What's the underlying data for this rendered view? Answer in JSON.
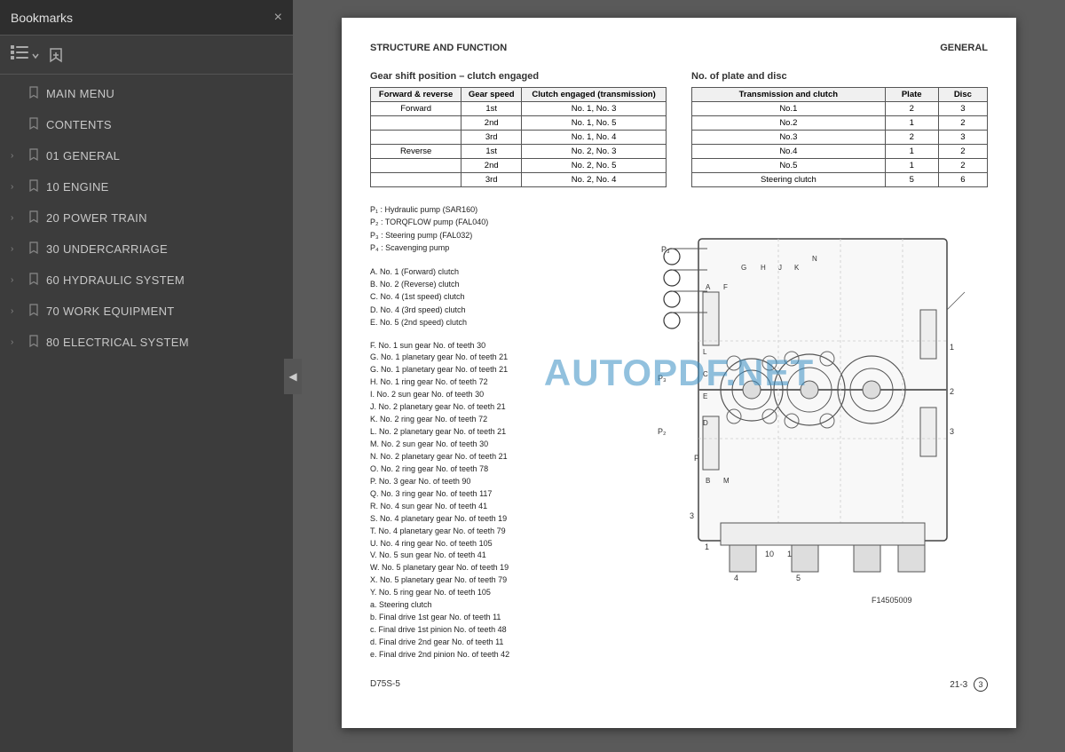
{
  "sidebar": {
    "title": "Bookmarks",
    "close_label": "×",
    "toolbar": {
      "list_icon": "☰",
      "bookmark_icon": "🔖"
    },
    "items": [
      {
        "id": "main-menu",
        "label": "MAIN MENU",
        "has_arrow": false
      },
      {
        "id": "contents",
        "label": "CONTENTS",
        "has_arrow": false
      },
      {
        "id": "general",
        "label": "01 GENERAL",
        "has_arrow": true
      },
      {
        "id": "engine",
        "label": "10 ENGINE",
        "has_arrow": true
      },
      {
        "id": "power-train",
        "label": "20 POWER TRAIN",
        "has_arrow": true
      },
      {
        "id": "undercarriage",
        "label": "30 UNDERCARRIAGE",
        "has_arrow": true
      },
      {
        "id": "hydraulic",
        "label": "60 HYDRAULIC SYSTEM",
        "has_arrow": true
      },
      {
        "id": "work-equipment",
        "label": "70 WORK EQUIPMENT",
        "has_arrow": true
      },
      {
        "id": "electrical",
        "label": "80 ELECTRICAL SYSTEM",
        "has_arrow": true
      }
    ],
    "collapse_arrow": "◀"
  },
  "page": {
    "header_left": "STRUCTURE AND FUNCTION",
    "header_right": "GENERAL",
    "watermark": "AUTOPDF.NET",
    "gear_table": {
      "title": "Gear shift position – clutch engaged",
      "headers": [
        "Forward & reverse",
        "Gear speed",
        "Clutch engaged (transmission)"
      ],
      "rows": [
        [
          "Forward",
          "1st",
          "No. 1, No. 3"
        ],
        [
          "",
          "2nd",
          "No. 1, No. 5"
        ],
        [
          "",
          "3rd",
          "No. 1, No. 4"
        ],
        [
          "Reverse",
          "1st",
          "No. 2, No. 3"
        ],
        [
          "",
          "2nd",
          "No. 2, No. 5"
        ],
        [
          "",
          "3rd",
          "No. 2, No. 4"
        ]
      ]
    },
    "plate_table": {
      "title": "No. of plate and disc",
      "headers": [
        "Transmission and clutch",
        "Plate",
        "Disc"
      ],
      "rows": [
        [
          "No.1",
          "2",
          "3"
        ],
        [
          "No.2",
          "1",
          "2"
        ],
        [
          "No.3",
          "2",
          "3"
        ],
        [
          "No.4",
          "1",
          "2"
        ],
        [
          "No.5",
          "1",
          "2"
        ],
        [
          "Steering clutch",
          "5",
          "6"
        ]
      ]
    },
    "pumps": [
      "P₁ : Hydraulic pump (SAR160)",
      "P₂ : TORQFLOW pump (FAL040)",
      "P₃ : Steering pump (FAL032)",
      "P₄ : Scavenging pump"
    ],
    "clutches": [
      "A.  No. 1 (Forward) clutch",
      "B.  No. 2 (Reverse) clutch",
      "C.  No. 4 (1st speed) clutch",
      "D.  No. 4 (3rd speed) clutch",
      "E.  No. 5 (2nd speed) clutch"
    ],
    "components": [
      {
        "letter": "F.",
        "name": "No. 1 sun gear",
        "detail": "No. of teeth",
        "value": "30"
      },
      {
        "letter": "G.",
        "name": "No. 1 planetary gear",
        "detail": "No. of teeth",
        "value": "21"
      },
      {
        "letter": "G.",
        "name": "No. 1 planetary gear",
        "detail": "No. of teeth",
        "value": "21"
      },
      {
        "letter": "H.",
        "name": "No. 1 ring gear",
        "detail": "No. of teeth",
        "value": "72"
      },
      {
        "letter": "I.",
        "name": "No. 2 sun gear",
        "detail": "No. of teeth",
        "value": "30"
      },
      {
        "letter": "J.",
        "name": "No. 2 planetary gear",
        "detail": "No. of teeth",
        "value": "21"
      },
      {
        "letter": "K.",
        "name": "No. 2 ring gear",
        "detail": "No. of teeth",
        "value": "72"
      },
      {
        "letter": "L.",
        "name": "No. 2 planetary gear",
        "detail": "No. of teeth",
        "value": "21"
      },
      {
        "letter": "M.",
        "name": "No. 2 sun gear",
        "detail": "No. of teeth",
        "value": "30"
      },
      {
        "letter": "N.",
        "name": "No. 2 planetary gear",
        "detail": "No. of teeth",
        "value": "21"
      },
      {
        "letter": "O.",
        "name": "No. 2 ring gear",
        "detail": "No. of teeth",
        "value": "78"
      },
      {
        "letter": "P.",
        "name": "No. 3 gear",
        "detail": "No. of teeth",
        "value": "90"
      },
      {
        "letter": "Q.",
        "name": "No. 3 ring gear",
        "detail": "No. of teeth",
        "value": "117"
      },
      {
        "letter": "R.",
        "name": "No. 4 sun gear",
        "detail": "No. of teeth",
        "value": "41"
      },
      {
        "letter": "S.",
        "name": "No. 4 planetary gear",
        "detail": "No. of teeth",
        "value": "19"
      },
      {
        "letter": "T.",
        "name": "No. 4 planetary gear",
        "detail": "No. of teeth",
        "value": "79"
      },
      {
        "letter": "U.",
        "name": "No. 4 ring gear",
        "detail": "No. of teeth",
        "value": "105"
      },
      {
        "letter": "V.",
        "name": "No. 5 sun gear",
        "detail": "No. of teeth",
        "value": "41"
      },
      {
        "letter": "W.",
        "name": "No. 5 planetary gear",
        "detail": "No. of teeth",
        "value": "19"
      },
      {
        "letter": "X.",
        "name": "No. 5 planetary gear",
        "detail": "No. of teeth",
        "value": "79"
      },
      {
        "letter": "Y.",
        "name": "No. 5 ring gear",
        "detail": "No. of teeth",
        "value": "105"
      },
      {
        "letter": "a.",
        "name": "Steering clutch",
        "detail": "",
        "value": ""
      },
      {
        "letter": "b.",
        "name": "Final drive 1st gear",
        "detail": "No. of teeth",
        "value": "11"
      },
      {
        "letter": "c.",
        "name": "Final drive 1st pinion",
        "detail": "No. of teeth",
        "value": "48"
      },
      {
        "letter": "d.",
        "name": "Final drive 2nd gear",
        "detail": "No. of teeth",
        "value": "11"
      },
      {
        "letter": "e.",
        "name": "Final drive 2nd pinion",
        "detail": "No. of teeth",
        "value": "42"
      }
    ],
    "figure_label": "F14505009",
    "doc_number": "D75S-5",
    "page_number": "21-3",
    "page_badge": "3"
  }
}
